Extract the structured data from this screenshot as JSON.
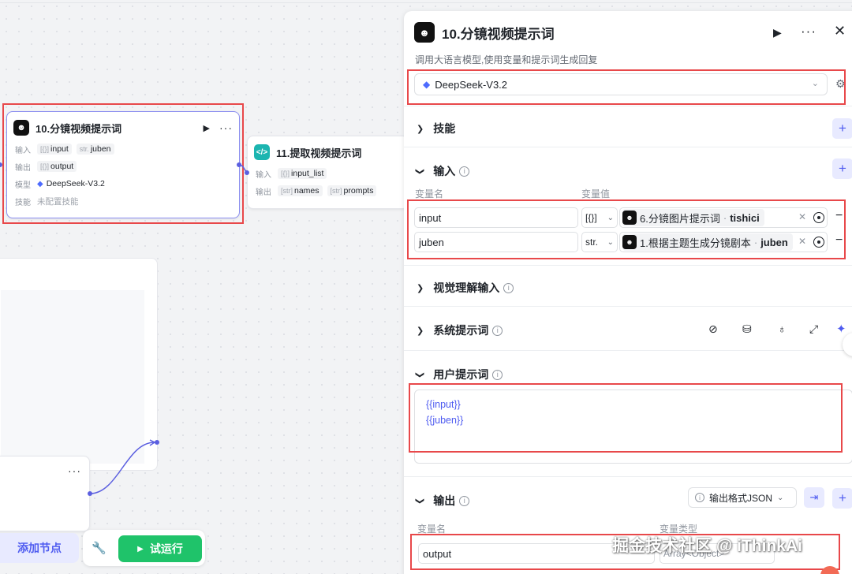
{
  "canvas": {
    "node_main": {
      "title": "10.分镜视频提示词",
      "input_label": "输入",
      "input_vars": [
        {
          "type": "[{}]",
          "name": "input"
        },
        {
          "type": "str.",
          "name": "juben"
        }
      ],
      "output_label": "输出",
      "output_vars": [
        {
          "type": "[{}]",
          "name": "output"
        }
      ],
      "model_label": "模型",
      "model_value": "DeepSeek-V3.2",
      "skill_label": "技能",
      "skill_value": "未配置技能"
    },
    "node_extract": {
      "title": "11.提取视频提示词",
      "input_label": "输入",
      "input_vars": [
        {
          "type": "[{}]",
          "name": "input_list"
        }
      ],
      "output_label": "输出",
      "output_vars": [
        {
          "type": "[str]",
          "name": "names"
        },
        {
          "type": "[str]",
          "name": "prompts"
        }
      ]
    },
    "bottom": {
      "add_node": "添加节点",
      "run": "试运行"
    }
  },
  "panel": {
    "title": "10.分镜视频提示词",
    "description": "调用大语言模型,使用变量和提示词生成回复",
    "model": "DeepSeek-V3.2",
    "sections": {
      "skills": "技能",
      "input": "输入",
      "vision": "视觉理解输入",
      "system_prompt": "系统提示词",
      "user_prompt": "用户提示词",
      "output": "输出"
    },
    "input_columns": {
      "name": "变量名",
      "value": "变量值"
    },
    "inputs": [
      {
        "name": "input",
        "type": "[{}]",
        "source": "6.分镜图片提示词",
        "var": "tishici"
      },
      {
        "name": "juben",
        "type": "str.",
        "source": "1.根据主题生成分镜剧本",
        "var": "juben"
      }
    ],
    "user_prompt_lines": [
      "{{input}}",
      "{{juben}}"
    ],
    "output_format": "输出格式JSON",
    "output_columns": {
      "name": "变量名",
      "type": "变量类型"
    },
    "outputs": [
      {
        "name": "output",
        "type": "Array<Object>"
      }
    ]
  },
  "watermark": "掘金技术社区 @ iThinkAi",
  "colors": {
    "accent": "#4e5bf0",
    "run_green": "#1fc36a",
    "annotation_red": "#e8484a"
  }
}
